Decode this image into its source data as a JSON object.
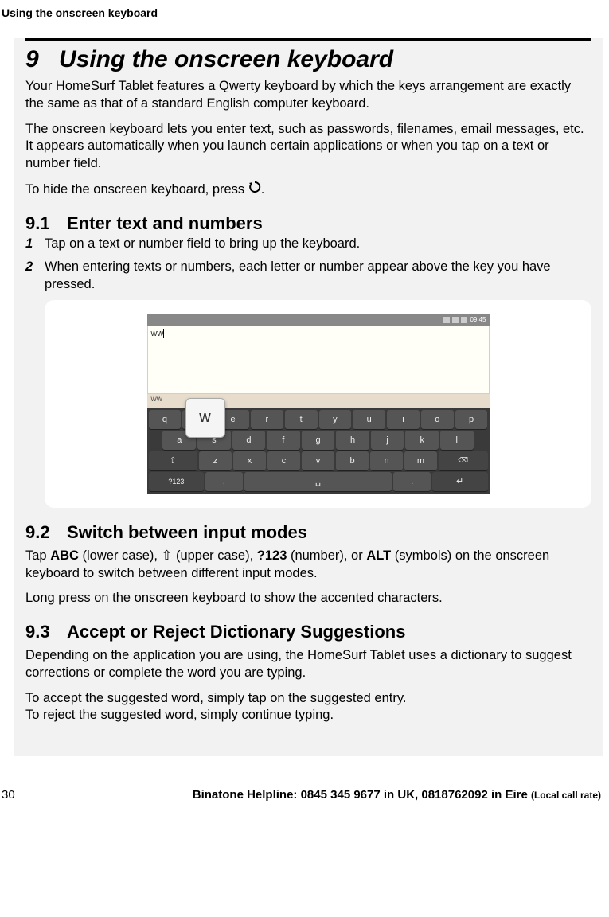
{
  "header": {
    "running": "Using the onscreen keyboard"
  },
  "chapter": {
    "num": "9",
    "title": "Using the onscreen keyboard"
  },
  "intro": {
    "p1": "Your HomeSurf Tablet features a Qwerty keyboard by which the keys arrangement are exactly the same as that of a standard English computer keyboard.",
    "p2": "The onscreen keyboard lets you enter text, such as passwords, filenames, email messages, etc. It appears automatically when you launch certain applications or when you tap on a text or number field.",
    "p3a": "To hide the onscreen keyboard, press ",
    "p3b": "."
  },
  "s91": {
    "num": "9.1",
    "title": "Enter text and numbers",
    "step1": "Tap on a text or number field to bring up the keyboard.",
    "step2": "When entering texts or numbers, each letter or number appear above the key you have pressed."
  },
  "figure": {
    "status_time": "09:45",
    "typed": "ww",
    "suggestion": "ww",
    "popup": "w",
    "rows": {
      "r1": [
        "q",
        "w",
        "e",
        "r",
        "t",
        "y",
        "u",
        "i",
        "o",
        "p"
      ],
      "r2": [
        "a",
        "s",
        "d",
        "f",
        "g",
        "h",
        "j",
        "k",
        "l"
      ],
      "r3": [
        "⇧",
        "z",
        "x",
        "c",
        "v",
        "b",
        "n",
        "m",
        "⌫"
      ],
      "r4": [
        "?123",
        ",",
        "␣",
        ".",
        "↵"
      ]
    }
  },
  "s92": {
    "num": "9.2",
    "title": "Switch between input modes",
    "p1a": "Tap ",
    "abc": "ABC",
    "p1b": " (lower case), ⇧ (upper case), ",
    "q123": "?123",
    "p1c": " (number), or ",
    "alt": "ALT",
    "p1d": " (symbols) on the onscreen keyboard to switch between different input modes.",
    "p2": "Long press on the onscreen keyboard to show the accented characters."
  },
  "s93": {
    "num": "9.3",
    "title": "Accept or Reject Dictionary Suggestions",
    "p1": "Depending on the application you are using, the HomeSurf Tablet uses a dictionary to suggest corrections or complete the word you are typing.",
    "p2": "To accept the suggested word, simply tap on the suggested entry.",
    "p3": "To reject the suggested word, simply continue typing."
  },
  "footer": {
    "page": "30",
    "helpline_main": "Binatone Helpline: 0845 345 9677 in UK, 0818762092 in Eire ",
    "helpline_small": "(Local call rate)"
  }
}
